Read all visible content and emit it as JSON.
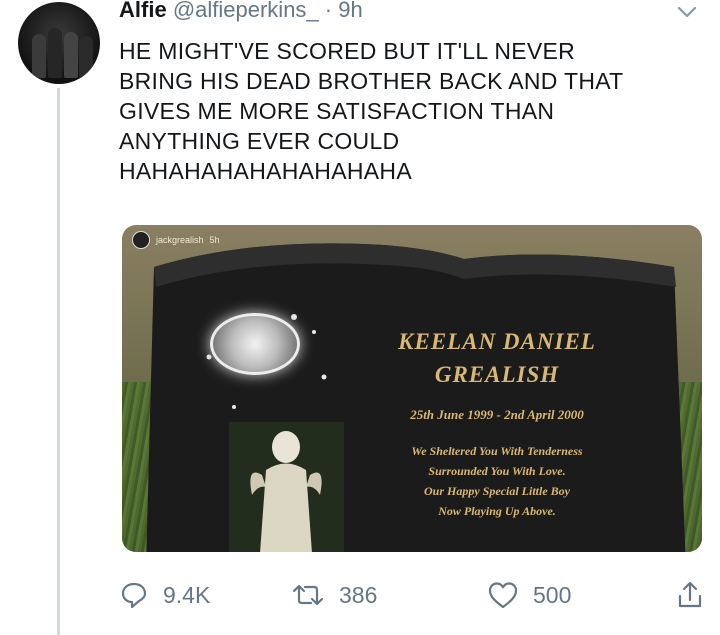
{
  "tweet": {
    "author_name": "Alfie",
    "handle": "@alfieperkins_",
    "separator": "·",
    "time": "9h",
    "text": "HE MIGHT'VE SCORED BUT IT'LL NEVER\nBRING HIS DEAD BROTHER BACK AND THAT\nGIVES ME MORE SATISFACTION THAN\nANYTHING EVER COULD\nHAHAHAHAHAHAHAHAHA"
  },
  "media": {
    "overlay_username": "jackgrealish",
    "overlay_time": "5h",
    "headstone": {
      "name_line_1": "KEELAN DANIEL",
      "name_line_2": "GREALISH",
      "dates": "25th June 1999 - 2nd April 2000",
      "verse": [
        "We Sheltered You With Tenderness",
        "Surrounded You With Love.",
        "Our Happy Special Little Boy",
        "Now Playing Up Above."
      ]
    }
  },
  "actions": {
    "reply_count": "9.4K",
    "retweet_count": "386",
    "like_count": "500"
  },
  "icons": {
    "chevron": "chevron-down-icon",
    "reply": "reply-icon",
    "retweet": "retweet-icon",
    "like": "heart-icon",
    "share": "share-icon"
  },
  "colors": {
    "text": "#14171a",
    "secondary": "#657786",
    "thread_line": "#cfd9de",
    "engraving_gold": "#d8b873"
  }
}
